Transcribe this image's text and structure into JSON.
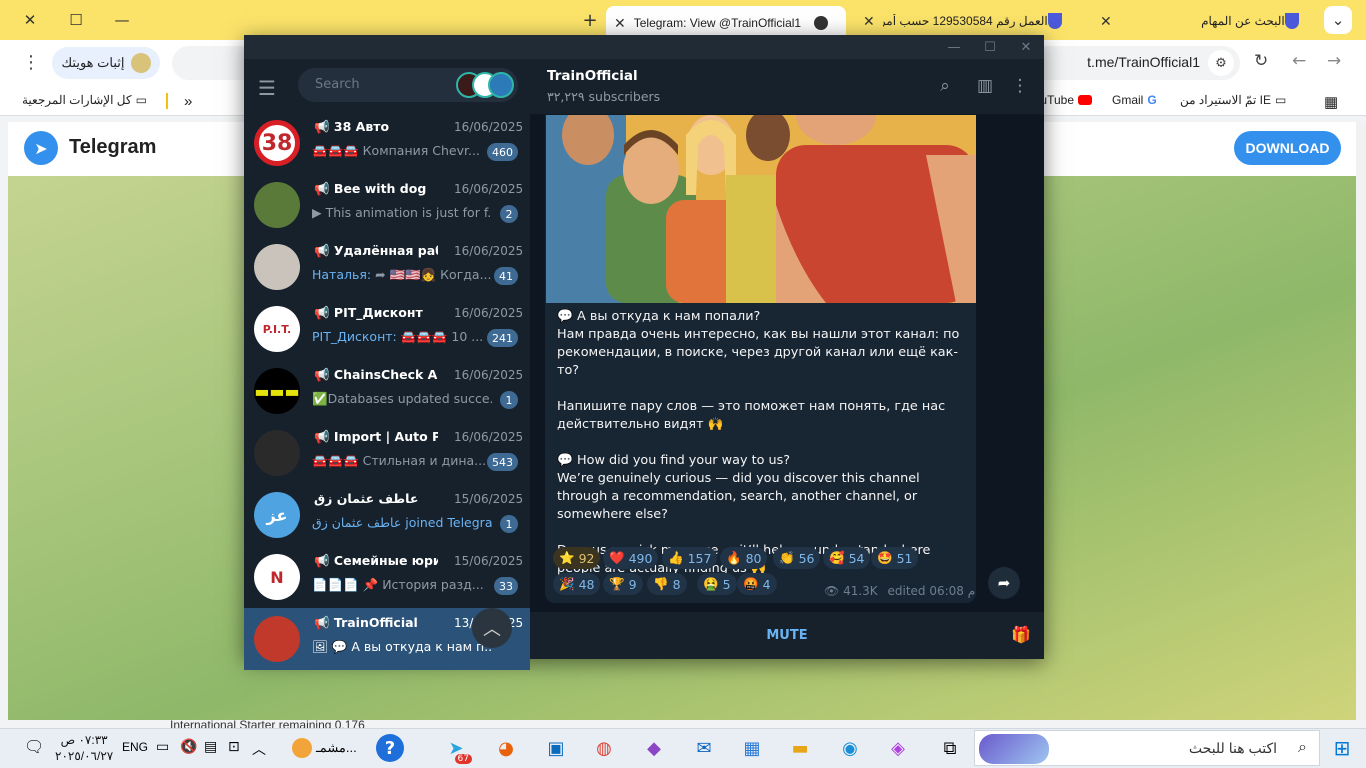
{
  "browser": {
    "tabs": [
      {
        "title": "البحث عن المهام"
      },
      {
        "title": "العمل رقم 129530584 حسب أمر"
      },
      {
        "title": "Telegram: View @TrainOfficial1"
      }
    ],
    "new_tab": "+",
    "address": "t.me/TrainOfficial1",
    "verify_label": "إثبات هويتك",
    "bookmarks": [
      "كل الإشارات المرجعية",
      "تمّ الاستيراد من IE",
      "Gmail",
      "YouTube"
    ],
    "more_bookmarks": "»"
  },
  "site": {
    "brand": "Telegram",
    "download": "DOWNLOAD",
    "below_text": "International   Starter                                                          remaining                                               0.176"
  },
  "telegram": {
    "search_placeholder": "Search",
    "chats": [
      {
        "name": "📢 38 Авто",
        "date": "16/06/2025",
        "preview": "🚘🚘🚘 Компания Chevr...",
        "badge": "460",
        "avatar_text": "38",
        "avatar_color": "#ffffff"
      },
      {
        "name": "📢 Bee with dog",
        "date": "16/06/2025",
        "preview": "▶ This animation is just for f...",
        "badge": "2",
        "avatar_text": "",
        "avatar_color": "#5a7a3a"
      },
      {
        "name": "📢 Удалённая рабо...",
        "date": "16/06/2025",
        "preview_hl": "Наталья:",
        "preview": " ➦ 🇺🇸🇺🇸👧 Когда...",
        "badge": "41",
        "avatar_text": "",
        "avatar_color": "#c9c3bb"
      },
      {
        "name": "📢 PIT_Дисконт",
        "date": "16/06/2025",
        "preview_hl": "PIT_Дисконт:",
        "preview": " 🚘🚘🚘 10 ...",
        "badge": "241",
        "avatar_text": "P.I.T.",
        "avatar_color": "#ffffff"
      },
      {
        "name": "📢 ChainsCheck AML",
        "date": "16/06/2025",
        "preview": "✅Databases updated succe...",
        "badge": "1",
        "avatar_text": "▬▬▬",
        "avatar_color": "#000000"
      },
      {
        "name": "📢 Import | Auto Pr...",
        "date": "16/06/2025",
        "preview": "🚘🚘🚘 Стильная и дина...",
        "badge": "543",
        "avatar_text": "",
        "avatar_color": "#2a2a2a"
      },
      {
        "name": "عاطف عثمان زق",
        "date": "15/06/2025",
        "preview_hl": "عاطف عثمان زق joined Telegram",
        "preview": "",
        "badge": "1",
        "avatar_text": "عز",
        "avatar_color": "#4fa3e0"
      },
      {
        "name": "📢 Семейные юрис...",
        "date": "15/06/2025",
        "preview": "📄📄📄 📌 История разд...",
        "badge": "33",
        "avatar_text": "N",
        "avatar_color": "#ffffff"
      },
      {
        "name": "📢 TrainOfficial",
        "date": "13/06/2025",
        "preview": "🖼 💬 А вы откуда к нам п...",
        "badge": "",
        "avatar_text": "",
        "avatar_color": "#c0392b"
      }
    ],
    "channel": {
      "title": "TrainOfficial",
      "subscribers": "٣٢,٢٢٩ subscribers",
      "message": "💬 А вы откуда к нам попали?\nНам правда очень интересно, как вы нашли этот канал: по рекомендации, в поиске, через другой канал или ещё как-то?\n\nНапишите пару слов — это поможет нам понять, где нас действительно видят 🙌\n\n💬 How did you find your way to us?\nWe’re genuinely curious — did you discover this channel through a recommendation, search, another channel, or somewhere else?\n\nDrop us a quick message — it’ll help us understand where people are actually finding us 🙌",
      "reactions": [
        {
          "emoji": "⭐",
          "count": "92"
        },
        {
          "emoji": "❤️",
          "count": "490"
        },
        {
          "emoji": "👍",
          "count": "157"
        },
        {
          "emoji": "🔥",
          "count": "80"
        },
        {
          "emoji": "👏",
          "count": "56"
        },
        {
          "emoji": "🥰",
          "count": "54"
        },
        {
          "emoji": "🤩",
          "count": "51"
        },
        {
          "emoji": "🎉",
          "count": "48"
        },
        {
          "emoji": "🏆",
          "count": "9"
        },
        {
          "emoji": "👎",
          "count": "8"
        },
        {
          "emoji": "🤮",
          "count": "5"
        },
        {
          "emoji": "🤬",
          "count": "4"
        }
      ],
      "views": "41.3K",
      "edited": "edited 06:08 م",
      "mute": "MUTE"
    }
  },
  "taskbar": {
    "search_placeholder": "اكتب هنا للبحث",
    "time": "٠٧:٣٣ ص",
    "date": "٢٠٢٥/٠٦/٢٧",
    "lang": "ENG",
    "weather": "مشمـ...",
    "telegram_badge": "67"
  }
}
